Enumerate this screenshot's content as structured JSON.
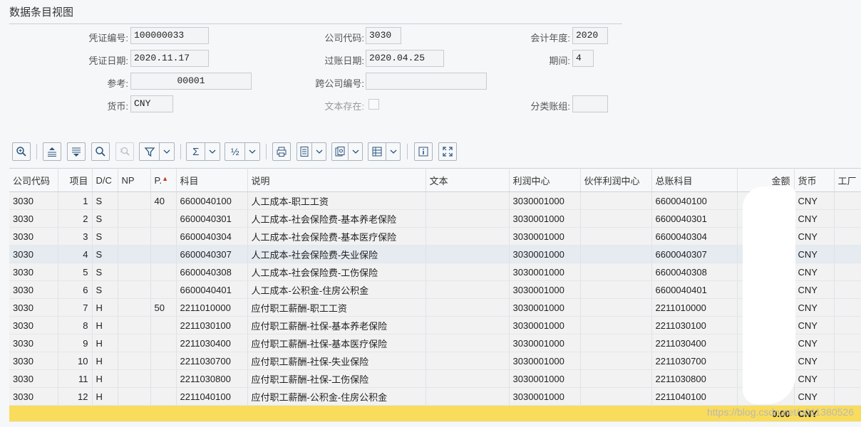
{
  "title": "数据条目视图",
  "header": {
    "doc_no_label": "凭证编号:",
    "doc_no": "100000033",
    "company_label": "公司代码:",
    "company": "3030",
    "fiscal_year_label": "会计年度:",
    "fiscal_year": "2020",
    "doc_date_label": "凭证日期:",
    "doc_date": "2020.11.17",
    "posting_date_label": "过账日期:",
    "posting_date": "2020.04.25",
    "period_label": "期间:",
    "period": "4",
    "reference_label": "参考:",
    "reference": "00001",
    "cross_company_label": "跨公司编号:",
    "cross_company": "",
    "currency_label": "货币:",
    "currency": "CNY",
    "text_exists_label": "文本存在:",
    "ledger_group_label": "分类账组:",
    "ledger_group": ""
  },
  "toolbar": {
    "icons": [
      "zoom-in-icon",
      "align-top-icon",
      "align-filter-icon",
      "search-icon",
      "search-next-icon",
      "filter-icon",
      "sum-icon",
      "subtotal-icon",
      "print-icon",
      "export-icon",
      "view-icon",
      "layout-icon",
      "info-icon",
      "fullscreen-icon"
    ],
    "sum_glyph": "Σ",
    "subtotal_glyph": "½"
  },
  "table": {
    "columns": [
      "公司代码",
      "项目",
      "D/C",
      "NP",
      "P.",
      "科目",
      "说明",
      "文本",
      "利润中心",
      "伙伴利润中心",
      "总账科目",
      "金额",
      "货币",
      "工厂"
    ],
    "rows": [
      [
        "3030",
        "1",
        "S",
        "",
        "40",
        "6600040100",
        "人工成本-职工工资",
        "",
        "3030001000",
        "",
        "6600040100",
        "",
        "CNY",
        ""
      ],
      [
        "3030",
        "2",
        "S",
        "",
        "",
        "6600040301",
        "人工成本-社会保险费-基本养老保险",
        "",
        "3030001000",
        "",
        "6600040301",
        "",
        "CNY",
        ""
      ],
      [
        "3030",
        "3",
        "S",
        "",
        "",
        "6600040304",
        "人工成本-社会保险费-基本医疗保险",
        "",
        "3030001000",
        "",
        "6600040304",
        "",
        "CNY",
        ""
      ],
      [
        "3030",
        "4",
        "S",
        "",
        "",
        "6600040307",
        "人工成本-社会保险费-失业保险",
        "",
        "3030001000",
        "",
        "6600040307",
        "",
        "CNY",
        ""
      ],
      [
        "3030",
        "5",
        "S",
        "",
        "",
        "6600040308",
        "人工成本-社会保险费-工伤保险",
        "",
        "3030001000",
        "",
        "6600040308",
        "",
        "CNY",
        ""
      ],
      [
        "3030",
        "6",
        "S",
        "",
        "",
        "6600040401",
        "人工成本-公积金-住房公积金",
        "",
        "3030001000",
        "",
        "6600040401",
        "",
        "CNY",
        ""
      ],
      [
        "3030",
        "7",
        "H",
        "",
        "50",
        "2211010000",
        "应付职工薪酬-职工工资",
        "",
        "3030001000",
        "",
        "2211010000",
        "",
        "CNY",
        ""
      ],
      [
        "3030",
        "8",
        "H",
        "",
        "",
        "2211030100",
        "应付职工薪酬-社保-基本养老保险",
        "",
        "3030001000",
        "",
        "2211030100",
        "",
        "CNY",
        ""
      ],
      [
        "3030",
        "9",
        "H",
        "",
        "",
        "2211030400",
        "应付职工薪酬-社保-基本医疗保险",
        "",
        "3030001000",
        "",
        "2211030400",
        "",
        "CNY",
        ""
      ],
      [
        "3030",
        "10",
        "H",
        "",
        "",
        "2211030700",
        "应付职工薪酬-社保-失业保险",
        "",
        "3030001000",
        "",
        "2211030700",
        "",
        "CNY",
        ""
      ],
      [
        "3030",
        "11",
        "H",
        "",
        "",
        "2211030800",
        "应付职工薪酬-社保-工伤保险",
        "",
        "3030001000",
        "",
        "2211030800",
        "",
        "CNY",
        ""
      ],
      [
        "3030",
        "12",
        "H",
        "",
        "",
        "2211040100",
        "应付职工薪酬-公积金-住房公积金",
        "",
        "3030001000",
        "",
        "2211040100",
        "",
        "CNY",
        ""
      ]
    ],
    "selected_row": 3,
    "total": {
      "amount": "0.00",
      "currency": "CNY"
    }
  },
  "watermark": "https://blog.csdn.net/u011380526"
}
